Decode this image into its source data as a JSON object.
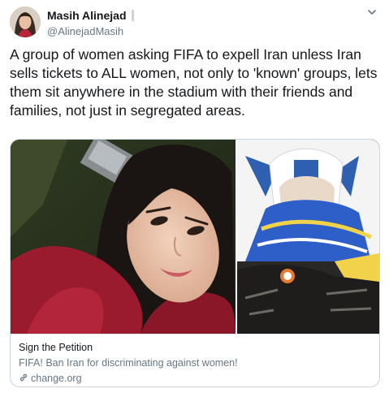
{
  "tweet": {
    "author": {
      "display_name": "Masih Alinejad",
      "handle": "@AlinejadMasih"
    },
    "text": "A group of women asking FIFA to expell Iran unless Iran sells tickets to ALL women, not only  to 'known' groups, lets them sit anywhere in the stadium with their friends and families, not just in segregated areas.",
    "card": {
      "title": "Sign the Petition",
      "description": "FIFA! Ban Iran for discriminating against women!",
      "domain": "change.org"
    }
  },
  "icons": [
    "more-caret-icon",
    "link-icon"
  ],
  "colors": {
    "text_primary": "#14171a",
    "text_secondary": "#657786",
    "card_border": "#ccd6dd",
    "scarf_red": "#9b1b2e"
  }
}
